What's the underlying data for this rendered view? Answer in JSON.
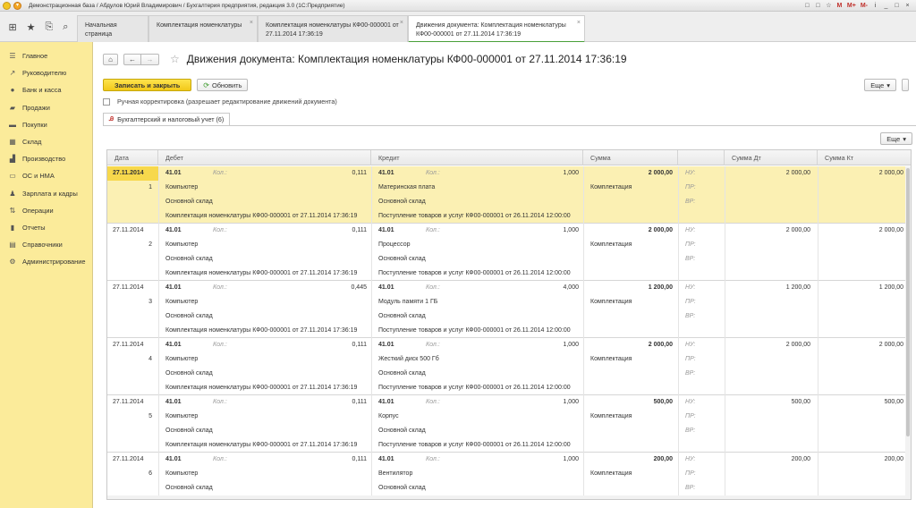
{
  "window": {
    "title": "Демонстрационная база / Абдулов Юрий Владимирович / Бухгалтерия предприятия, редакция 3.0  (1С:Предприятие)",
    "icons": [
      "□",
      "□",
      "☆",
      "M",
      "M+",
      "M-",
      "i",
      "_",
      "□",
      "×"
    ]
  },
  "tabs": [
    {
      "label": "Начальная страница",
      "closable": false
    },
    {
      "label": "Комплектация номенклатуры",
      "closable": true
    },
    {
      "label": "Комплектация номенклатуры КФ00-000001 от 27.11.2014 17:36:19",
      "closable": true
    },
    {
      "label": "Движения документа: Комплектация номенклатуры КФ00-000001 от 27.11.2014 17:36:19",
      "closable": true,
      "active": true
    }
  ],
  "sidebar": {
    "items": [
      {
        "label": "Главное",
        "icon": "menu-icon"
      },
      {
        "label": "Руководителю",
        "icon": "trend-icon"
      },
      {
        "label": "Банк и касса",
        "icon": "coin-icon"
      },
      {
        "label": "Продажи",
        "icon": "cart-icon"
      },
      {
        "label": "Покупки",
        "icon": "basket-icon"
      },
      {
        "label": "Склад",
        "icon": "warehouse-icon"
      },
      {
        "label": "Производство",
        "icon": "factory-icon"
      },
      {
        "label": "ОС и НМА",
        "icon": "truck-icon"
      },
      {
        "label": "Зарплата и кадры",
        "icon": "person-icon"
      },
      {
        "label": "Операции",
        "icon": "operations-icon"
      },
      {
        "label": "Отчеты",
        "icon": "chart-icon"
      },
      {
        "label": "Справочники",
        "icon": "book-icon"
      },
      {
        "label": "Администрирование",
        "icon": "gear-icon"
      }
    ]
  },
  "page": {
    "title": "Движения документа: Комплектация номенклатуры КФ00-000001 от 27.11.2014 17:36:19",
    "save_close": "Записать и закрыть",
    "refresh": "Обновить",
    "more": "Еще",
    "manual_edit": "Ручная корректировка (разрешает редактирование движений документа)",
    "subtab": "Бухгалтерский и налоговый учет (6)"
  },
  "table": {
    "columns": [
      "Дата",
      "Дебет",
      "Кредит",
      "Сумма",
      "",
      "Сумма Дт",
      "Сумма Кт"
    ],
    "kol_label": "Кол.:",
    "nu": "НУ:",
    "pr": "ПР:",
    "vr": "ВР:",
    "rows": [
      {
        "date": "27.11.2014",
        "num": "1",
        "dt_acc": "41.01",
        "dt_qty": "0,111",
        "dt_sub1": "Компьютер",
        "dt_sub2": "Основной склад",
        "dt_sub3": "Комплектация номенклатуры КФ00-000001 от 27.11.2014 17:36:19",
        "kt_acc": "41.01",
        "kt_qty": "1,000",
        "kt_sub1": "Материнская плата",
        "kt_sub2": "Основной склад",
        "kt_sub3": "Поступление товаров и услуг КФ00-000001 от 26.11.2014 12:00:00",
        "sum": "2 000,00",
        "content": "Комплектация",
        "sum_dt": "2 000,00",
        "sum_kt": "2 000,00"
      },
      {
        "date": "27.11.2014",
        "num": "2",
        "dt_acc": "41.01",
        "dt_qty": "0,111",
        "dt_sub1": "Компьютер",
        "dt_sub2": "Основной склад",
        "dt_sub3": "Комплектация номенклатуры КФ00-000001 от 27.11.2014 17:36:19",
        "kt_acc": "41.01",
        "kt_qty": "1,000",
        "kt_sub1": "Процессор",
        "kt_sub2": "Основной склад",
        "kt_sub3": "Поступление товаров и услуг КФ00-000001 от 26.11.2014 12:00:00",
        "sum": "2 000,00",
        "content": "Комплектация",
        "sum_dt": "2 000,00",
        "sum_kt": "2 000,00"
      },
      {
        "date": "27.11.2014",
        "num": "3",
        "dt_acc": "41.01",
        "dt_qty": "0,445",
        "dt_sub1": "Компьютер",
        "dt_sub2": "Основной склад",
        "dt_sub3": "Комплектация номенклатуры КФ00-000001 от 27.11.2014 17:36:19",
        "kt_acc": "41.01",
        "kt_qty": "4,000",
        "kt_sub1": "Модуль памяти 1 ГБ",
        "kt_sub2": "Основной склад",
        "kt_sub3": "Поступление товаров и услуг КФ00-000001 от 26.11.2014 12:00:00",
        "sum": "1 200,00",
        "content": "Комплектация",
        "sum_dt": "1 200,00",
        "sum_kt": "1 200,00"
      },
      {
        "date": "27.11.2014",
        "num": "4",
        "dt_acc": "41.01",
        "dt_qty": "0,111",
        "dt_sub1": "Компьютер",
        "dt_sub2": "Основной склад",
        "dt_sub3": "Комплектация номенклатуры КФ00-000001 от 27.11.2014 17:36:19",
        "kt_acc": "41.01",
        "kt_qty": "1,000",
        "kt_sub1": "Жесткий диск 500 Гб",
        "kt_sub2": "Основной склад",
        "kt_sub3": "Поступление товаров и услуг КФ00-000001 от 26.11.2014 12:00:00",
        "sum": "2 000,00",
        "content": "Комплектация",
        "sum_dt": "2 000,00",
        "sum_kt": "2 000,00"
      },
      {
        "date": "27.11.2014",
        "num": "5",
        "dt_acc": "41.01",
        "dt_qty": "0,111",
        "dt_sub1": "Компьютер",
        "dt_sub2": "Основной склад",
        "dt_sub3": "Комплектация номенклатуры КФ00-000001 от 27.11.2014 17:36:19",
        "kt_acc": "41.01",
        "kt_qty": "1,000",
        "kt_sub1": "Корпус",
        "kt_sub2": "Основной склад",
        "kt_sub3": "Поступление товаров и услуг КФ00-000001 от 26.11.2014 12:00:00",
        "sum": "500,00",
        "content": "Комплектация",
        "sum_dt": "500,00",
        "sum_kt": "500,00"
      },
      {
        "date": "27.11.2014",
        "num": "6",
        "dt_acc": "41.01",
        "dt_qty": "0,111",
        "dt_sub1": "Компьютер",
        "dt_sub2": "Основной склад",
        "dt_sub3": "",
        "kt_acc": "41.01",
        "kt_qty": "1,000",
        "kt_sub1": "Вентилятор",
        "kt_sub2": "Основной склад",
        "kt_sub3": "",
        "sum": "200,00",
        "content": "Комплектация",
        "sum_dt": "200,00",
        "sum_kt": "200,00"
      }
    ]
  }
}
